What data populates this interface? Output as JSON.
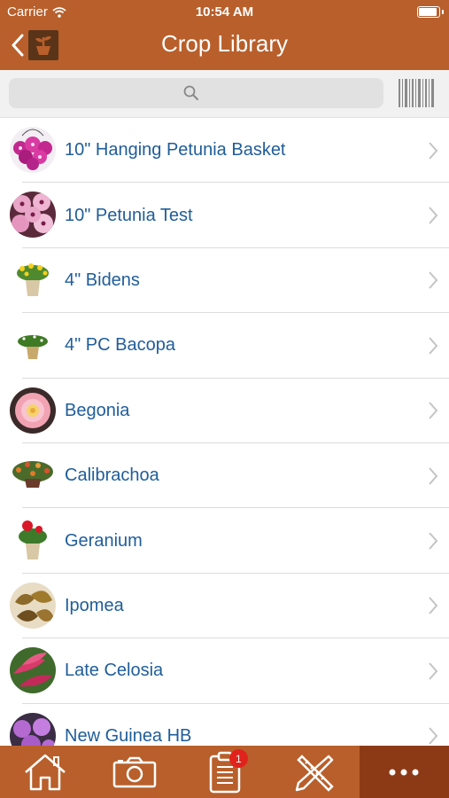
{
  "status_bar": {
    "carrier": "Carrier",
    "time": "10:54 AM",
    "battery_level": 0.95
  },
  "nav": {
    "title": "Crop Library",
    "back_icon": "chevron-left-icon",
    "home_thumb_icon": "potted-plant-icon"
  },
  "search": {
    "placeholder": "",
    "value": "",
    "icon": "search-icon",
    "barcode_icon": "barcode-icon"
  },
  "crops": [
    {
      "label": "10\" Hanging Petunia Basket",
      "thumb": "petunia-basket"
    },
    {
      "label": "10\" Petunia Test",
      "thumb": "petunia"
    },
    {
      "label": "4\" Bidens",
      "thumb": "bidens"
    },
    {
      "label": "4\" PC Bacopa",
      "thumb": "bacopa"
    },
    {
      "label": "Begonia",
      "thumb": "begonia"
    },
    {
      "label": "Calibrachoa",
      "thumb": "calibrachoa"
    },
    {
      "label": "Geranium",
      "thumb": "geranium"
    },
    {
      "label": "Ipomea",
      "thumb": "ipomea"
    },
    {
      "label": "Late Celosia",
      "thumb": "celosia"
    },
    {
      "label": "New Guinea HB",
      "thumb": "new-guinea"
    }
  ],
  "tabs": [
    {
      "name": "home",
      "icon": "house-icon"
    },
    {
      "name": "camera",
      "icon": "camera-icon"
    },
    {
      "name": "tasks",
      "icon": "clipboard-icon",
      "badge": "1"
    },
    {
      "name": "tools",
      "icon": "pencil-ruler-icon"
    },
    {
      "name": "more",
      "icon": "more-dots-icon",
      "active": true
    }
  ],
  "colors": {
    "brand": "#b85f2b",
    "brand_dark": "#8c3a16",
    "link": "#1f5d99",
    "badge": "#e0231c"
  }
}
